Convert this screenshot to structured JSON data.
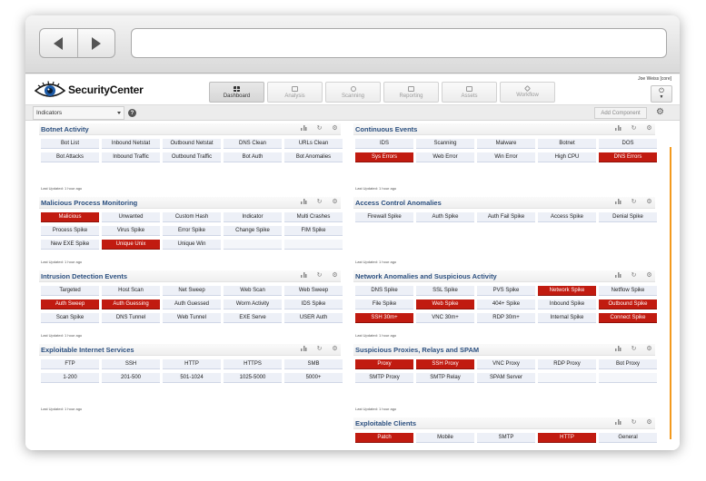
{
  "app": {
    "name": "SecurityCenter",
    "user": "Joe Weiss [core]"
  },
  "nav": [
    {
      "label": "Dashboard",
      "active": true,
      "icon": "grid-icon"
    },
    {
      "label": "Analysis",
      "active": false,
      "icon": "chart-icon"
    },
    {
      "label": "Scanning",
      "active": false,
      "icon": "search-icon"
    },
    {
      "label": "Reporting",
      "active": false,
      "icon": "document-icon"
    },
    {
      "label": "Assets",
      "active": false,
      "icon": "database-icon"
    },
    {
      "label": "Workflow",
      "active": false,
      "icon": "diamond-icon"
    }
  ],
  "toolbar": {
    "dashboard_select": "Indicators",
    "help": "?",
    "add_component": "Add Component"
  },
  "colors": {
    "alert": "#c11b10",
    "normal": "#edf0f7",
    "title": "#2b4f7f",
    "scroll_accent": "#f39a1e"
  },
  "widgets": [
    {
      "title": "Botnet Activity",
      "updated": "Last Updated: 1 hour ago",
      "cells": [
        {
          "t": "Bot List",
          "s": "n"
        },
        {
          "t": "Inbound Netstat",
          "s": "n"
        },
        {
          "t": "Outbound Netstat",
          "s": "n"
        },
        {
          "t": "DNS Clean",
          "s": "n"
        },
        {
          "t": "URLs Clean",
          "s": "n"
        },
        {
          "t": "Bot Attacks",
          "s": "n"
        },
        {
          "t": "Inbound Traffic",
          "s": "n"
        },
        {
          "t": "Outbound Traffic",
          "s": "n"
        },
        {
          "t": "Bot Auth",
          "s": "n"
        },
        {
          "t": "Bot Anomalies",
          "s": "n"
        }
      ]
    },
    {
      "title": "Continuous Events",
      "updated": "Last Updated: 1 hour ago",
      "cells": [
        {
          "t": "IDS",
          "s": "n"
        },
        {
          "t": "Scanning",
          "s": "n"
        },
        {
          "t": "Malware",
          "s": "n"
        },
        {
          "t": "Botnet",
          "s": "n"
        },
        {
          "t": "DOS",
          "s": "n"
        },
        {
          "t": "Sys Errors",
          "s": "r"
        },
        {
          "t": "Web Error",
          "s": "n"
        },
        {
          "t": "Win Error",
          "s": "n"
        },
        {
          "t": "High CPU",
          "s": "n"
        },
        {
          "t": "DNS Errors",
          "s": "r"
        }
      ]
    },
    {
      "title": "Malicious Process Monitoring",
      "updated": "Last Updated: 1 hour ago",
      "cells": [
        {
          "t": "Malicious",
          "s": "r"
        },
        {
          "t": "Unwanted",
          "s": "n"
        },
        {
          "t": "Custom Hash",
          "s": "n"
        },
        {
          "t": "Indicator",
          "s": "n"
        },
        {
          "t": "Multi Crashes",
          "s": "n"
        },
        {
          "t": "Process Spike",
          "s": "n"
        },
        {
          "t": "Virus Spike",
          "s": "n"
        },
        {
          "t": "Error Spike",
          "s": "n"
        },
        {
          "t": "Change Spike",
          "s": "n"
        },
        {
          "t": "FIM Spike",
          "s": "n"
        },
        {
          "t": "New EXE Spike",
          "s": "n"
        },
        {
          "t": "Unique Unix",
          "s": "r"
        },
        {
          "t": "Unique Win",
          "s": "n"
        },
        {
          "t": "",
          "s": "e"
        },
        {
          "t": "",
          "s": "e"
        }
      ]
    },
    {
      "title": "Access Control Anomalies",
      "updated": "Last Updated: 1 hour ago",
      "cells": [
        {
          "t": "Firewall Spike",
          "s": "n"
        },
        {
          "t": "Auth Spike",
          "s": "n"
        },
        {
          "t": "Auth Fail Spike",
          "s": "n"
        },
        {
          "t": "Access Spike",
          "s": "n"
        },
        {
          "t": "Denial Spike",
          "s": "n"
        }
      ]
    },
    {
      "title": "Intrusion Detection Events",
      "updated": "Last Updated: 1 hour ago",
      "cells": [
        {
          "t": "Targeted",
          "s": "n"
        },
        {
          "t": "Host Scan",
          "s": "n"
        },
        {
          "t": "Net Sweep",
          "s": "n"
        },
        {
          "t": "Web Scan",
          "s": "n"
        },
        {
          "t": "Web Sweep",
          "s": "n"
        },
        {
          "t": "Auth Sweep",
          "s": "r"
        },
        {
          "t": "Auth Guessing",
          "s": "r"
        },
        {
          "t": "Auth Guessed",
          "s": "n"
        },
        {
          "t": "Worm Activity",
          "s": "n"
        },
        {
          "t": "IDS Spike",
          "s": "n"
        },
        {
          "t": "Scan Spike",
          "s": "n"
        },
        {
          "t": "DNS Tunnel",
          "s": "n"
        },
        {
          "t": "Web Tunnel",
          "s": "n"
        },
        {
          "t": "EXE Serve",
          "s": "n"
        },
        {
          "t": "USER Auth",
          "s": "n"
        }
      ]
    },
    {
      "title": "Network Anomalies and Suspicious Activity",
      "updated": "Last Updated: 1 hour ago",
      "cells": [
        {
          "t": "DNS Spike",
          "s": "n"
        },
        {
          "t": "SSL Spike",
          "s": "n"
        },
        {
          "t": "PVS Spike",
          "s": "n"
        },
        {
          "t": "Network Spike",
          "s": "r"
        },
        {
          "t": "Netflow Spike",
          "s": "n"
        },
        {
          "t": "File Spike",
          "s": "n"
        },
        {
          "t": "Web Spike",
          "s": "r"
        },
        {
          "t": "404+ Spike",
          "s": "n"
        },
        {
          "t": "Inbound Spike",
          "s": "n"
        },
        {
          "t": "Outbound Spike",
          "s": "r"
        },
        {
          "t": "SSH 30m+",
          "s": "r"
        },
        {
          "t": "VNC 30m+",
          "s": "n"
        },
        {
          "t": "RDP 30m+",
          "s": "n"
        },
        {
          "t": "Internal Spike",
          "s": "n"
        },
        {
          "t": "Connect Spike",
          "s": "r"
        }
      ]
    },
    {
      "title": "Exploitable Internet Services",
      "updated": "Last Updated: 1 hour ago",
      "cells": [
        {
          "t": "FTP",
          "s": "n"
        },
        {
          "t": "SSH",
          "s": "n"
        },
        {
          "t": "HTTP",
          "s": "n"
        },
        {
          "t": "HTTPS",
          "s": "n"
        },
        {
          "t": "SMB",
          "s": "n"
        },
        {
          "t": "1-200",
          "s": "n"
        },
        {
          "t": "201-500",
          "s": "n"
        },
        {
          "t": "501-1024",
          "s": "n"
        },
        {
          "t": "1025-5000",
          "s": "n"
        },
        {
          "t": "5000+",
          "s": "n"
        }
      ]
    },
    {
      "title": "Suspicious Proxies, Relays and SPAM",
      "updated": "Last Updated: 1 hour ago",
      "cells": [
        {
          "t": "Proxy",
          "s": "r"
        },
        {
          "t": "SSH Proxy",
          "s": "r"
        },
        {
          "t": "VNC Proxy",
          "s": "n"
        },
        {
          "t": "RDP Proxy",
          "s": "n"
        },
        {
          "t": "Bot Proxy",
          "s": "n"
        },
        {
          "t": "SMTP Proxy",
          "s": "n"
        },
        {
          "t": "SMTP Relay",
          "s": "n"
        },
        {
          "t": "SPAM Server",
          "s": "n"
        },
        {
          "t": "",
          "s": "e"
        },
        {
          "t": "",
          "s": "e"
        }
      ]
    },
    {
      "title": "Exploitable Clients",
      "updated": "",
      "cells": [
        {
          "t": "Patch",
          "s": "r"
        },
        {
          "t": "Mobile",
          "s": "n"
        },
        {
          "t": "SMTP",
          "s": "n"
        },
        {
          "t": "HTTP",
          "s": "r"
        },
        {
          "t": "General",
          "s": "n"
        }
      ]
    }
  ]
}
